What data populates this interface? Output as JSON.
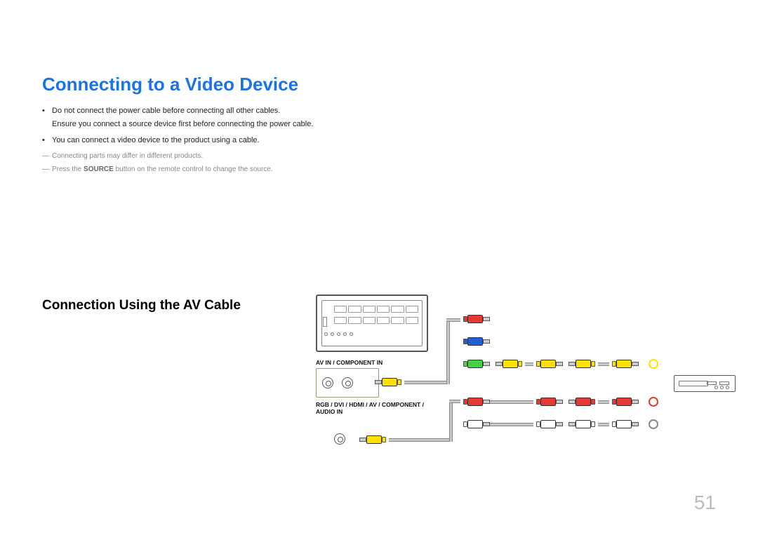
{
  "page": {
    "title": "Connecting to a Video Device",
    "bullets": [
      {
        "text": "Do not connect the power cable before connecting all other cables.",
        "sub": "Ensure you connect a source device first before connecting the power cable."
      },
      {
        "text": "You can connect a video device to the product using a cable."
      }
    ],
    "notes": {
      "note1": "Connecting parts may differ in different products.",
      "note2_prefix": "Press the ",
      "note2_bold": "SOURCE",
      "note2_suffix": " button on the remote control to change the source."
    },
    "subheading": "Connection Using the AV Cable",
    "port_labels": {
      "av_in": "AV IN / COMPONENT IN",
      "audio_in": "RGB / DVI / HDMI / AV / COMPONENT / AUDIO IN"
    },
    "page_number": "51"
  },
  "colors": {
    "title": "#1a73e8",
    "yellow": "#ffe100",
    "red": "#e53935",
    "blue": "#1e5fd6",
    "green": "#43d143",
    "white": "#ffffff"
  }
}
